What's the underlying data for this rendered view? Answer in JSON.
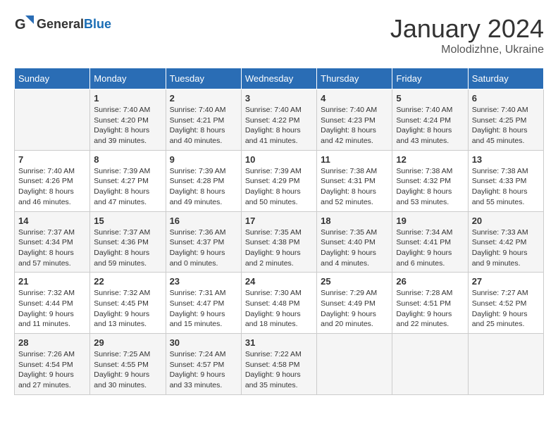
{
  "header": {
    "logo_general": "General",
    "logo_blue": "Blue",
    "month_title": "January 2024",
    "location": "Molodizhne, Ukraine"
  },
  "weekdays": [
    "Sunday",
    "Monday",
    "Tuesday",
    "Wednesday",
    "Thursday",
    "Friday",
    "Saturday"
  ],
  "weeks": [
    [
      {
        "day": "",
        "info": ""
      },
      {
        "day": "1",
        "info": "Sunrise: 7:40 AM\nSunset: 4:20 PM\nDaylight: 8 hours\nand 39 minutes."
      },
      {
        "day": "2",
        "info": "Sunrise: 7:40 AM\nSunset: 4:21 PM\nDaylight: 8 hours\nand 40 minutes."
      },
      {
        "day": "3",
        "info": "Sunrise: 7:40 AM\nSunset: 4:22 PM\nDaylight: 8 hours\nand 41 minutes."
      },
      {
        "day": "4",
        "info": "Sunrise: 7:40 AM\nSunset: 4:23 PM\nDaylight: 8 hours\nand 42 minutes."
      },
      {
        "day": "5",
        "info": "Sunrise: 7:40 AM\nSunset: 4:24 PM\nDaylight: 8 hours\nand 43 minutes."
      },
      {
        "day": "6",
        "info": "Sunrise: 7:40 AM\nSunset: 4:25 PM\nDaylight: 8 hours\nand 45 minutes."
      }
    ],
    [
      {
        "day": "7",
        "info": "Sunrise: 7:40 AM\nSunset: 4:26 PM\nDaylight: 8 hours\nand 46 minutes."
      },
      {
        "day": "8",
        "info": "Sunrise: 7:39 AM\nSunset: 4:27 PM\nDaylight: 8 hours\nand 47 minutes."
      },
      {
        "day": "9",
        "info": "Sunrise: 7:39 AM\nSunset: 4:28 PM\nDaylight: 8 hours\nand 49 minutes."
      },
      {
        "day": "10",
        "info": "Sunrise: 7:39 AM\nSunset: 4:29 PM\nDaylight: 8 hours\nand 50 minutes."
      },
      {
        "day": "11",
        "info": "Sunrise: 7:38 AM\nSunset: 4:31 PM\nDaylight: 8 hours\nand 52 minutes."
      },
      {
        "day": "12",
        "info": "Sunrise: 7:38 AM\nSunset: 4:32 PM\nDaylight: 8 hours\nand 53 minutes."
      },
      {
        "day": "13",
        "info": "Sunrise: 7:38 AM\nSunset: 4:33 PM\nDaylight: 8 hours\nand 55 minutes."
      }
    ],
    [
      {
        "day": "14",
        "info": "Sunrise: 7:37 AM\nSunset: 4:34 PM\nDaylight: 8 hours\nand 57 minutes."
      },
      {
        "day": "15",
        "info": "Sunrise: 7:37 AM\nSunset: 4:36 PM\nDaylight: 8 hours\nand 59 minutes."
      },
      {
        "day": "16",
        "info": "Sunrise: 7:36 AM\nSunset: 4:37 PM\nDaylight: 9 hours\nand 0 minutes."
      },
      {
        "day": "17",
        "info": "Sunrise: 7:35 AM\nSunset: 4:38 PM\nDaylight: 9 hours\nand 2 minutes."
      },
      {
        "day": "18",
        "info": "Sunrise: 7:35 AM\nSunset: 4:40 PM\nDaylight: 9 hours\nand 4 minutes."
      },
      {
        "day": "19",
        "info": "Sunrise: 7:34 AM\nSunset: 4:41 PM\nDaylight: 9 hours\nand 6 minutes."
      },
      {
        "day": "20",
        "info": "Sunrise: 7:33 AM\nSunset: 4:42 PM\nDaylight: 9 hours\nand 9 minutes."
      }
    ],
    [
      {
        "day": "21",
        "info": "Sunrise: 7:32 AM\nSunset: 4:44 PM\nDaylight: 9 hours\nand 11 minutes."
      },
      {
        "day": "22",
        "info": "Sunrise: 7:32 AM\nSunset: 4:45 PM\nDaylight: 9 hours\nand 13 minutes."
      },
      {
        "day": "23",
        "info": "Sunrise: 7:31 AM\nSunset: 4:47 PM\nDaylight: 9 hours\nand 15 minutes."
      },
      {
        "day": "24",
        "info": "Sunrise: 7:30 AM\nSunset: 4:48 PM\nDaylight: 9 hours\nand 18 minutes."
      },
      {
        "day": "25",
        "info": "Sunrise: 7:29 AM\nSunset: 4:49 PM\nDaylight: 9 hours\nand 20 minutes."
      },
      {
        "day": "26",
        "info": "Sunrise: 7:28 AM\nSunset: 4:51 PM\nDaylight: 9 hours\nand 22 minutes."
      },
      {
        "day": "27",
        "info": "Sunrise: 7:27 AM\nSunset: 4:52 PM\nDaylight: 9 hours\nand 25 minutes."
      }
    ],
    [
      {
        "day": "28",
        "info": "Sunrise: 7:26 AM\nSunset: 4:54 PM\nDaylight: 9 hours\nand 27 minutes."
      },
      {
        "day": "29",
        "info": "Sunrise: 7:25 AM\nSunset: 4:55 PM\nDaylight: 9 hours\nand 30 minutes."
      },
      {
        "day": "30",
        "info": "Sunrise: 7:24 AM\nSunset: 4:57 PM\nDaylight: 9 hours\nand 33 minutes."
      },
      {
        "day": "31",
        "info": "Sunrise: 7:22 AM\nSunset: 4:58 PM\nDaylight: 9 hours\nand 35 minutes."
      },
      {
        "day": "",
        "info": ""
      },
      {
        "day": "",
        "info": ""
      },
      {
        "day": "",
        "info": ""
      }
    ]
  ]
}
